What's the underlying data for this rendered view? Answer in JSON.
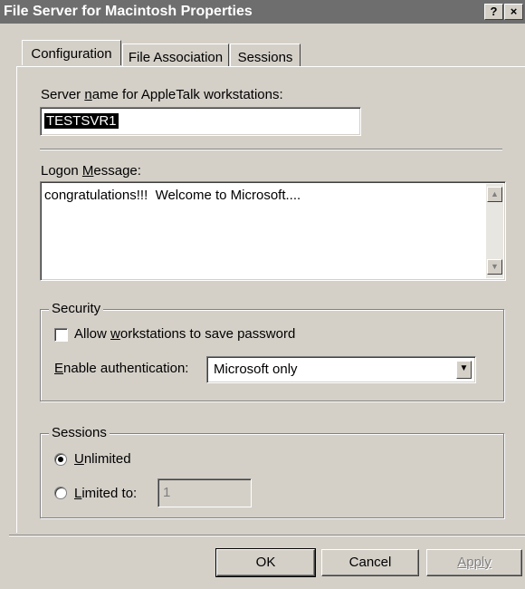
{
  "window": {
    "title": "File Server for Macintosh Properties",
    "help_label": "?",
    "close_label": "×"
  },
  "tabs": [
    {
      "label": "Configuration",
      "selected": true
    },
    {
      "label": "File Association",
      "selected": false
    },
    {
      "label": "Sessions",
      "selected": false
    }
  ],
  "server_name": {
    "label_pre": "Server ",
    "label_accel": "n",
    "label_post": "ame for AppleTalk workstations:",
    "value": "TESTSVR1"
  },
  "logon": {
    "label_pre": "Logon ",
    "label_accel": "M",
    "label_post": "essage:",
    "value": "congratulations!!!  Welcome to Microsoft...."
  },
  "security": {
    "caption": "Security",
    "save_password_pre": "Allow ",
    "save_password_accel": "w",
    "save_password_post": "orkstations to save password",
    "save_password_checked": false,
    "auth_accel": "E",
    "auth_post": "nable authentication:",
    "auth_value": "Microsoft only"
  },
  "sessions": {
    "caption": "Sessions",
    "unlimited_accel": "U",
    "unlimited_post": "nlimited",
    "unlimited_selected": true,
    "limited_accel": "L",
    "limited_post": "imited to:",
    "limited_value": "1"
  },
  "buttons": {
    "ok": "OK",
    "cancel": "Cancel",
    "apply": "Apply"
  }
}
